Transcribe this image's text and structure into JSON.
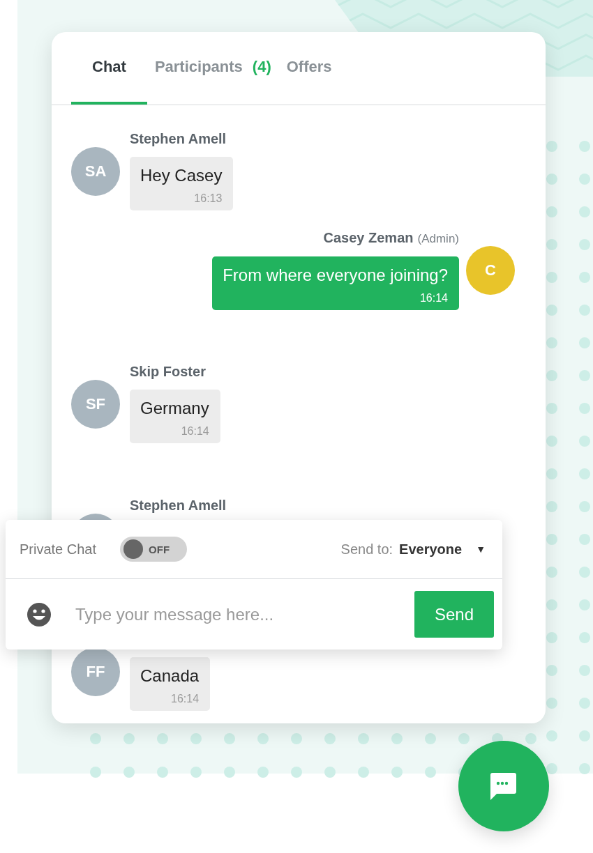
{
  "tabs": [
    {
      "label": "Chat",
      "selected": true
    },
    {
      "label": "Participants",
      "count": "(4)",
      "selected": false
    },
    {
      "label": "Offers",
      "selected": false
    }
  ],
  "messages": [
    {
      "kind": "incoming",
      "sender": "Stephen Amell",
      "initials": "SA",
      "text": "Hey Casey",
      "time": "16:13"
    },
    {
      "kind": "outgoing",
      "sender": "Casey Zeman",
      "role": "(Admin)",
      "initials": "C",
      "text": "From where everyone joining?",
      "time": "16:14"
    },
    {
      "kind": "incoming",
      "sender": "Skip Foster",
      "initials": "SF",
      "text": "Germany",
      "time": "16:14"
    },
    {
      "kind": "incoming",
      "sender": "Stephen Amell"
    },
    {
      "kind": "incoming",
      "initials": "FF",
      "text": "Canada",
      "time": "16:14"
    }
  ],
  "composer": {
    "private_chat": {
      "label": "Private Chat",
      "on": false,
      "state_label": "OFF"
    },
    "send_to": {
      "label": "Send to:",
      "value": "Everyone",
      "caret": "▼"
    },
    "message_field": {
      "placeholder": "Type your message here..."
    },
    "send_button": "Send"
  }
}
